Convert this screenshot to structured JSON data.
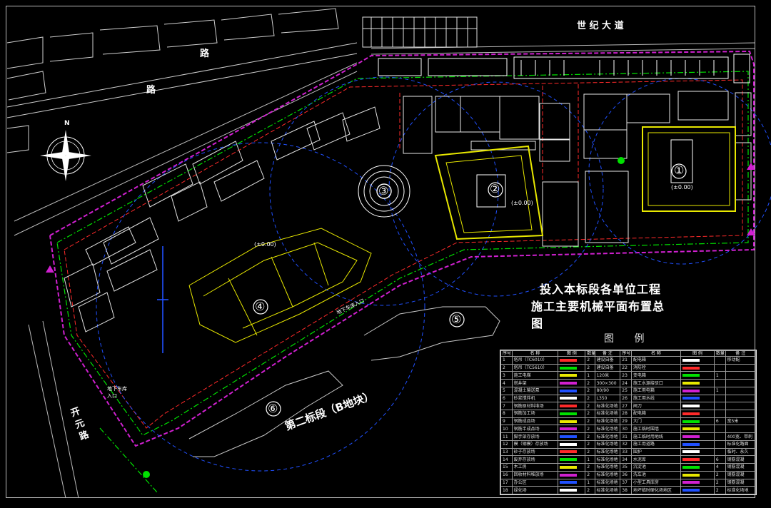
{
  "title": {
    "line1": "投入本标段各单位工程",
    "line2": "施工主要机械平面布置总图"
  },
  "roads": {
    "century_avenue": "世 纪 大 道",
    "road_left": "开 元 路",
    "road_top": "路",
    "road_top2": "路"
  },
  "sections": {
    "second_section": "第二标段（B地块）"
  },
  "building_numbers": [
    "①",
    "②",
    "③",
    "④",
    "⑤",
    "⑥"
  ],
  "elevations": {
    "e1": "(±0.00)",
    "e2": "(±0.00)",
    "e3": "(±0.00)"
  },
  "legend": {
    "title": "图 例",
    "headers": [
      "序号",
      "名 称",
      "图 例",
      "数量",
      "备 注",
      "序号",
      "名 称",
      "图 例",
      "数量",
      "备 注"
    ],
    "rows": [
      [
        "1",
        "塔吊（TC6010）",
        "",
        "2",
        "建设自备",
        "21",
        "配电箱",
        "",
        "",
        "移动配"
      ],
      [
        "2",
        "塔吊（TC5610）",
        "",
        "2",
        "建设自备",
        "22",
        "消防栓",
        "",
        "",
        ""
      ],
      [
        "3",
        "施工电梯",
        "",
        "1",
        "120米",
        "23",
        "变电箱",
        "",
        "1",
        ""
      ],
      [
        "4",
        "塔井架",
        "",
        "2",
        "300×300",
        "24",
        "施工水源接驳口",
        "",
        "",
        ""
      ],
      [
        "5",
        "混凝土输送泵",
        "",
        "2",
        "80/90",
        "25",
        "施工用电箱",
        "",
        "1",
        ""
      ],
      [
        "6",
        "砂浆搅拌机",
        "",
        "2",
        "L350",
        "26",
        "施工用水线",
        "",
        "",
        ""
      ],
      [
        "7",
        "钢筋原材料堆场",
        "",
        "2",
        "标准化场地",
        "27",
        "闸刀",
        "",
        "",
        ""
      ],
      [
        "8",
        "钢筋加工场",
        "",
        "2",
        "标准化场地",
        "28",
        "配电箱",
        "",
        "",
        ""
      ],
      [
        "9",
        "钢筋成品场",
        "",
        "2",
        "标准化场地",
        "29",
        "大门",
        "",
        "6",
        "宽5米"
      ],
      [
        "10",
        "钢筋半成品场",
        "",
        "2",
        "标准化场地",
        "30",
        "施工临时围墙",
        "",
        "",
        ""
      ],
      [
        "11",
        "脚手架存放场",
        "",
        "2",
        "标准化场地",
        "31",
        "施工临时用地线",
        "",
        "",
        "400宽、带刺"
      ],
      [
        "12",
        "模（钢模）存放场",
        "",
        "2",
        "标准化场地",
        "32",
        "施工用道路",
        "",
        "",
        "标准化路面"
      ],
      [
        "13",
        "砂子存放场",
        "",
        "2",
        "标准化场地",
        "33",
        "围护",
        "",
        "",
        "临时、永久"
      ],
      [
        "14",
        "废弃存放场",
        "",
        "1",
        "标准化场地",
        "34",
        "水泥库",
        "",
        "6",
        "钢筋混凝"
      ],
      [
        "15",
        "木工房",
        "",
        "2",
        "标准化场地",
        "35",
        "沉淀池",
        "",
        "4",
        "钢筋混凝"
      ],
      [
        "16",
        "回收材料堆放场",
        "",
        "2",
        "标准化场地",
        "36",
        "洗车池",
        "",
        "2",
        "钢筋混凝"
      ],
      [
        "17",
        "办公区",
        "",
        "1",
        "标准化场地",
        "37",
        "小型工具库房",
        "",
        "2",
        "钢筋混凝"
      ],
      [
        "18",
        "绿化场",
        "",
        "2",
        "标准化场地",
        "38",
        "地坪临时硬化场地区",
        "",
        "2",
        "标准化场地"
      ]
    ]
  },
  "colors": {
    "fence": "#d020d0",
    "green_line": "#00e000",
    "red_line": "#ff2a2a",
    "yellow": "#e8e800",
    "blue": "#2050ff",
    "white": "#ffffff",
    "cyan": "#00d0d0"
  },
  "compass": {
    "label": "N"
  },
  "labels": {
    "entrance": "地下车库入口",
    "entrance2": "地下车库入口",
    "sec2_label": "第二标段"
  }
}
